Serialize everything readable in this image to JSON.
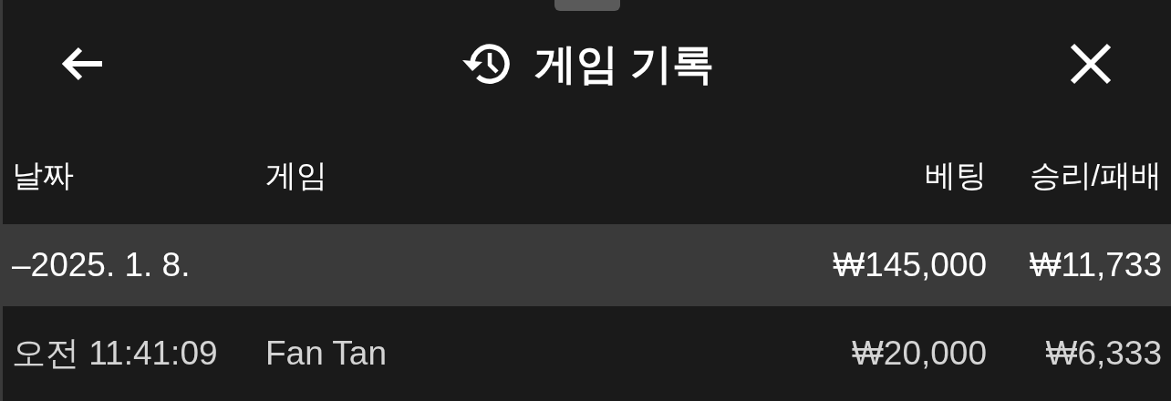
{
  "header": {
    "title": "게임 기록"
  },
  "table": {
    "columns": [
      "날짜",
      "게임",
      "베팅",
      "승리/패배"
    ],
    "rows": [
      {
        "kind": "group",
        "date": "–2025. 1. 8.",
        "bet": "₩145,000",
        "win_loss": "₩11,733"
      },
      {
        "kind": "entry",
        "date": "오전 11:41:09",
        "game": "Fan Tan",
        "bet": "₩20,000",
        "win_loss": "₩6,333"
      }
    ]
  }
}
